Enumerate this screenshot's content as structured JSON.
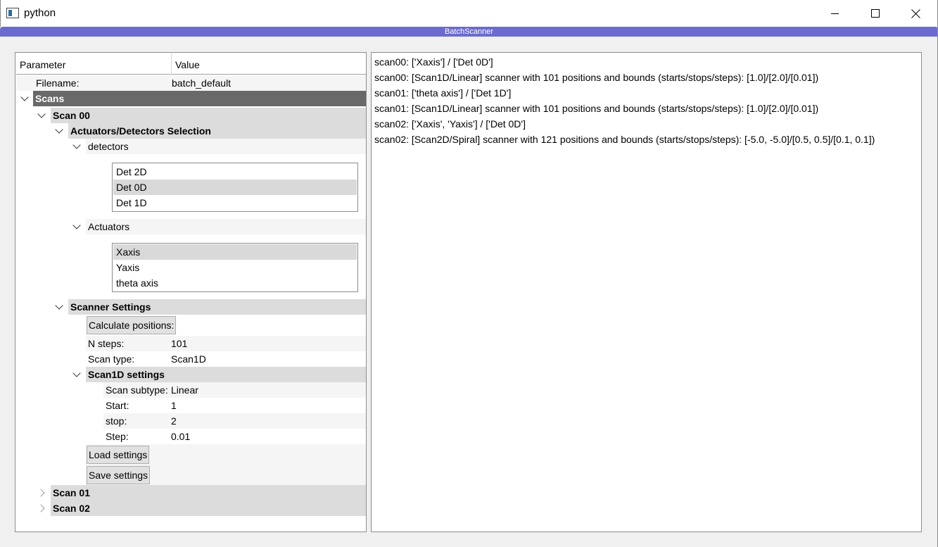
{
  "window": {
    "title": "python",
    "dock_title": "BatchScanner"
  },
  "tree": {
    "headers": {
      "parameter": "Parameter",
      "value": "Value"
    },
    "filename": {
      "label": "Filename:",
      "value": "batch_default"
    },
    "scans_label": "Scans",
    "scan00": {
      "label": "Scan 00",
      "actdet": {
        "label": "Actuators/Detectors Selection",
        "detectors": {
          "label": "detectors",
          "items": [
            "Det 2D",
            "Det 0D",
            "Det 1D"
          ],
          "selected": "Det 0D"
        },
        "actuators": {
          "label": "Actuators",
          "items": [
            "Xaxis",
            "Yaxis",
            "theta axis"
          ],
          "selected": "Xaxis"
        }
      },
      "scanner": {
        "label": "Scanner Settings",
        "calc_btn": "Calculate positions:",
        "nsteps": {
          "label": "N steps:",
          "value": "101"
        },
        "scan_type": {
          "label": "Scan type:",
          "value": "Scan1D"
        },
        "scan1d": {
          "label": "Scan1D settings",
          "subtype": {
            "label": "Scan subtype:",
            "value": "Linear"
          },
          "start": {
            "label": "Start:",
            "value": "1"
          },
          "stop": {
            "label": "stop:",
            "value": "2"
          },
          "step": {
            "label": "Step:",
            "value": "0.01"
          }
        }
      },
      "load_btn": "Load settings",
      "save_btn": "Save settings"
    },
    "scan01_label": "Scan 01",
    "scan02_label": "Scan 02"
  },
  "log": {
    "lines": [
      "scan00: ['Xaxis'] / ['Det 0D']",
      "scan00: [Scan1D/Linear] scanner with 101 positions and  bounds (starts/stops/steps): [1.0]/[2.0]/[0.01])",
      "scan01: ['theta axis'] / ['Det 1D']",
      "scan01: [Scan1D/Linear] scanner with 101 positions and  bounds (starts/stops/steps): [1.0]/[2.0]/[0.01])",
      "scan02: ['Xaxis', 'Yaxis'] / ['Det 0D']",
      "scan02: [Scan2D/Spiral] scanner with 121 positions and  bounds (starts/stops/steps): [-5.0, -5.0]/[0.5, 0.5]/[0.1, 0.1])"
    ]
  }
}
